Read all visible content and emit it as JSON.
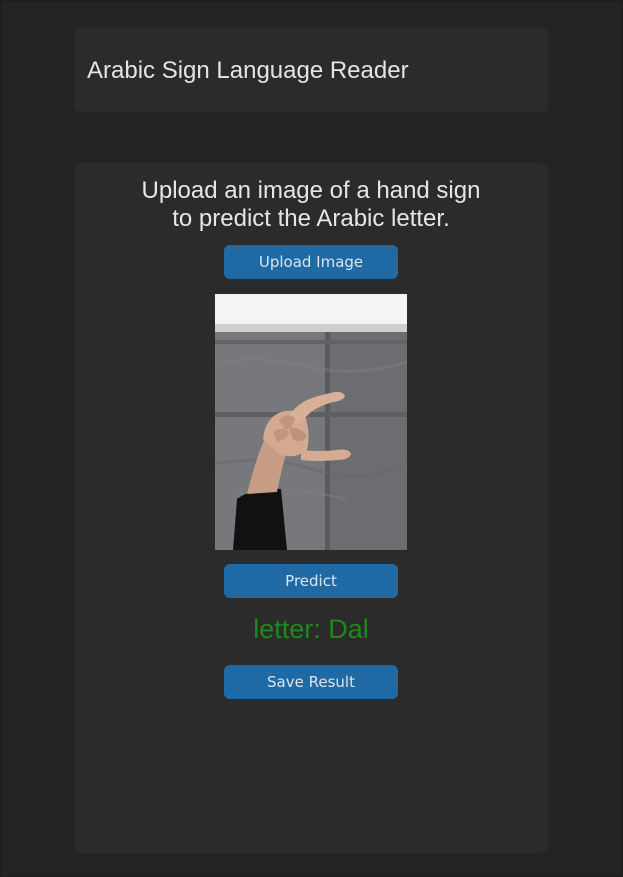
{
  "app": {
    "title": "Arabic Sign Language Reader"
  },
  "main": {
    "instruction_line1": "Upload an image of a hand sign",
    "instruction_line2": "to predict the Arabic letter.",
    "upload_label": "Upload Image",
    "predict_label": "Predict",
    "result_text": "letter: Dal",
    "save_label": "Save Result",
    "preview_image_icon": "hand-sign-photo"
  },
  "colors": {
    "background": "#242424",
    "card": "#2b2b2b",
    "button": "#1f6aa5",
    "result_text": "#1b8a1b"
  }
}
